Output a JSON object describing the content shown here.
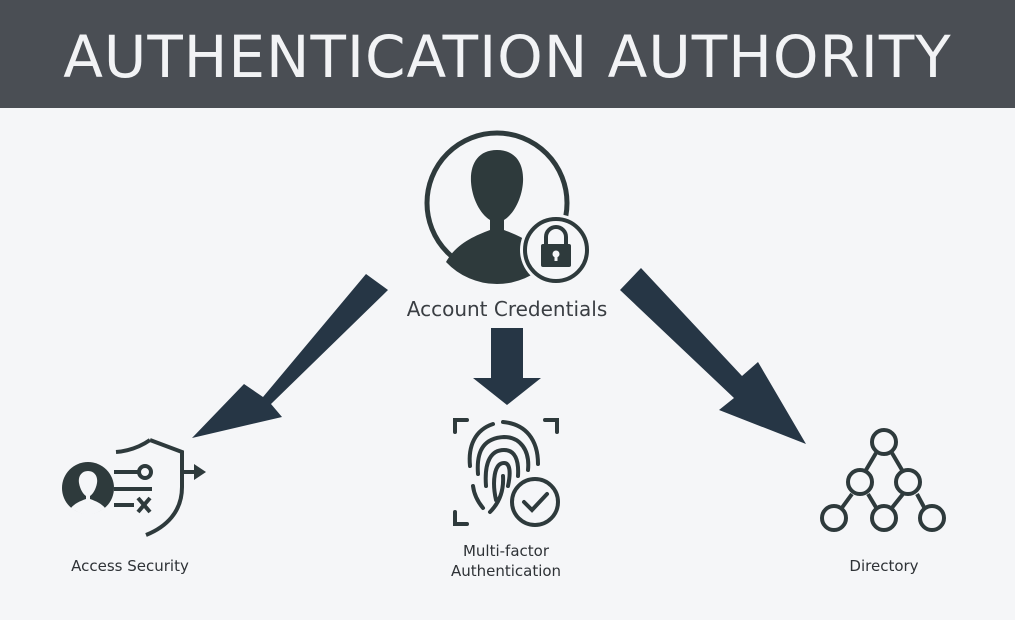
{
  "title": "AUTHENTICATION AUTHORITY",
  "center": {
    "label": "Account Credentials",
    "icon": "user-lock-icon"
  },
  "nodes": [
    {
      "label": "Access Security",
      "icon": "shield-access-icon"
    },
    {
      "label_line1": "Multi-factor",
      "label_line2": "Authentication",
      "icon": "fingerprint-check-icon"
    },
    {
      "label": "Directory",
      "icon": "directory-tree-icon"
    }
  ],
  "colors": {
    "header_bg": "#4a4e54",
    "title_text": "#f2f3f5",
    "arrow": "#263645",
    "icon_dark": "#2e3a3c",
    "background": "#f5f6f8"
  }
}
